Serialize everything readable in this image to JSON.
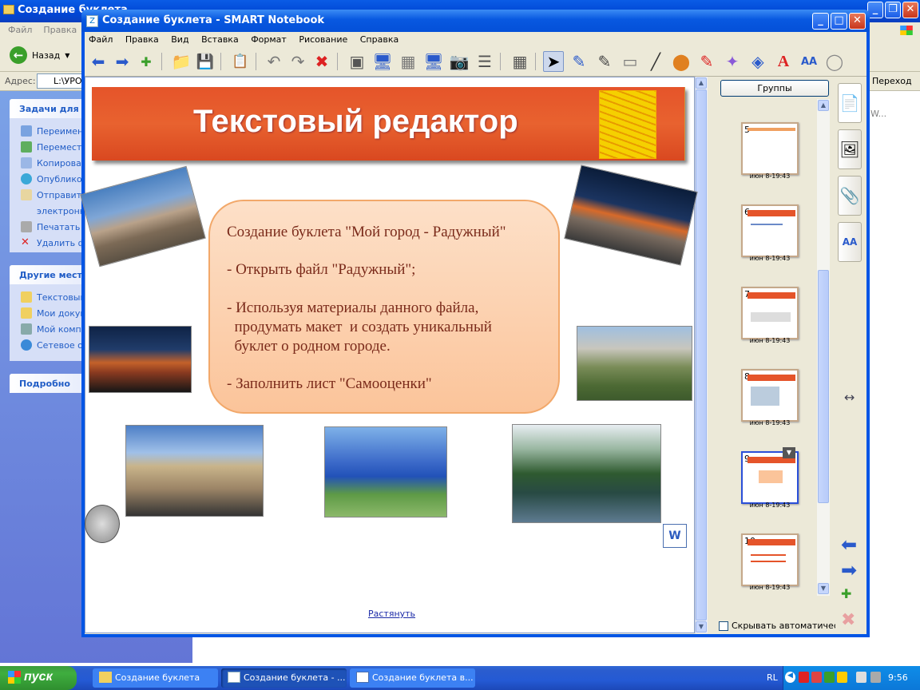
{
  "explorer": {
    "title": "Создание буклета",
    "menu": [
      "Файл",
      "Правка"
    ],
    "back_label": "Назад",
    "address_label": "Адрес:",
    "address_value": "L:\\УРО",
    "go_label": "Переход",
    "tasks_header": "Задачи для ф",
    "tasks": [
      "Переимен",
      "Перемести",
      "Копироват",
      "Опубликов",
      "Отправить",
      "электронн",
      "Печатать",
      "Удалить ф"
    ],
    "places_header": "Другие места",
    "places": [
      "Текстовый",
      "Мои докум",
      "Мой компь",
      "Сетевое о"
    ],
    "details_header": "Подробно",
    "right_text": "W..."
  },
  "notebook": {
    "title": "Создание буклета - SMART Notebook",
    "menu": [
      "Файл",
      "Правка",
      "Вид",
      "Вставка",
      "Формат",
      "Рисование",
      "Справка"
    ]
  },
  "slide": {
    "banner_title": "Текстовый редактор",
    "bubble_lines": [
      "Создание буклета \"Мой город - Радужный\"",
      "- Открыть файл \"Радужный\";",
      "- Используя материалы данного файла,",
      "  продумать макет  и создать уникальный",
      "  буклет о родном городе.",
      "- Заполнить лист \"Самооценки\""
    ],
    "stretch_link": "Растянуть"
  },
  "sorter": {
    "groups_button": "Группы",
    "pages": [
      {
        "num": "5",
        "time": "июн 8-19:43"
      },
      {
        "num": "6",
        "time": "июн 8-19:43"
      },
      {
        "num": "7",
        "time": "июн 8-19:43"
      },
      {
        "num": "8",
        "time": "июн 8-19:43"
      },
      {
        "num": "9",
        "time": "июн 8-19:43",
        "selected": true
      },
      {
        "num": "10",
        "time": "июн 8-19:43"
      }
    ],
    "autohide_label": "Скрывать автоматическ"
  },
  "taskbar": {
    "start_label": "пуск",
    "buttons": [
      "Создание буклета",
      "Создание буклета - ...",
      "Создание буклета в..."
    ],
    "lang": "RL",
    "clock": "9:56"
  },
  "colors": {
    "accent": "#0055e5",
    "banner": "#e5542a",
    "bubble": "#fbc49a",
    "text": "#7a2a1a"
  }
}
